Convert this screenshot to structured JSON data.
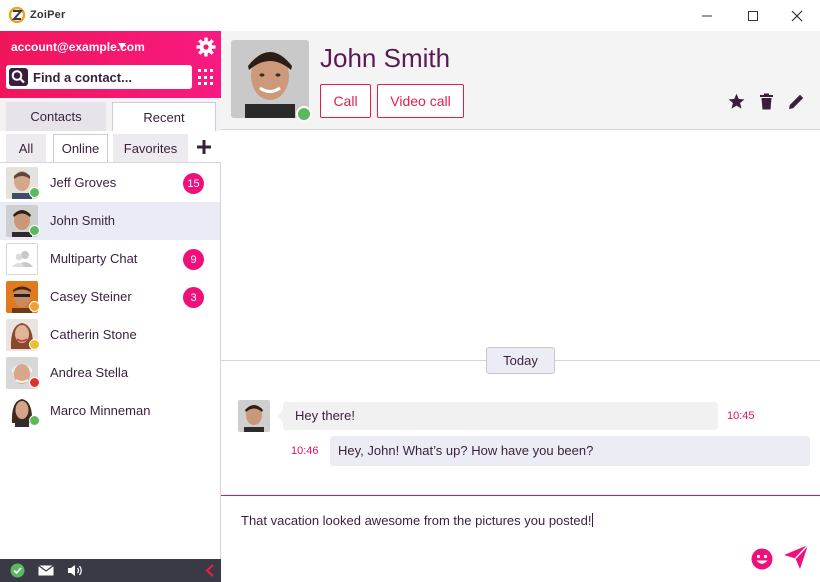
{
  "app": {
    "name": "ZoiPer"
  },
  "account": {
    "email": "account@example.com"
  },
  "search": {
    "placeholder": "Find a contact..."
  },
  "tabs": {
    "contacts": "Contacts",
    "recent": "Recent"
  },
  "filters": {
    "all": "All",
    "online": "Online",
    "favorites": "Favorites"
  },
  "contacts": [
    {
      "name": "Jeff Groves",
      "badge": "15",
      "status": "online"
    },
    {
      "name": "John Smith",
      "badge": "",
      "status": "online"
    },
    {
      "name": "Multiparty Chat",
      "badge": "9",
      "status": ""
    },
    {
      "name": "Casey Steiner",
      "badge": "3",
      "status": "away"
    },
    {
      "name": "Catherin Stone",
      "badge": "",
      "status": "idle"
    },
    {
      "name": "Andrea Stella",
      "badge": "",
      "status": "busy"
    },
    {
      "name": "Marco Minneman",
      "badge": "",
      "status": "online"
    }
  ],
  "header": {
    "name": "John Smith",
    "call": "Call",
    "video_call": "Video call"
  },
  "chat": {
    "day": "Today",
    "messages": [
      {
        "text": "Hey there!",
        "time": "10:45",
        "direction": "in"
      },
      {
        "text": "Hey, John! What’s up? How have you been?",
        "time": "10:46",
        "direction": "out"
      }
    ]
  },
  "composer": {
    "text": "That vacation looked awesome from the pictures you posted!"
  },
  "colors": {
    "accent": "#f0107a",
    "header_gradient_start": "#f0155a",
    "header_gradient_end": "#f81a82",
    "dark": "#3a1f3d",
    "online": "#5cb85c",
    "away": "#f0a030",
    "idle": "#e8c030",
    "busy": "#d9342b"
  }
}
